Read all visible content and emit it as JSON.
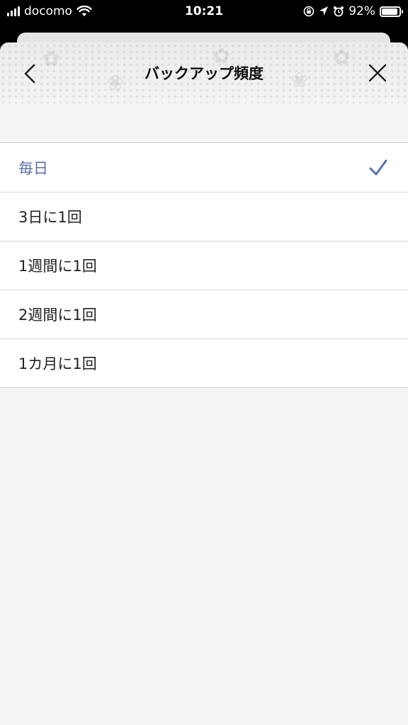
{
  "status_bar": {
    "carrier": "docomo",
    "time": "10:21",
    "battery": "92%",
    "battery_level": 0.92,
    "icons": [
      "signal-icon",
      "wifi-icon",
      "orientation-lock-icon",
      "location-icon",
      "alarm-icon",
      "battery-icon"
    ]
  },
  "header": {
    "title": "バックアップ頻度",
    "back_icon": "chevron-left-icon",
    "close_icon": "close-icon"
  },
  "options": [
    {
      "label": "毎日",
      "selected": true
    },
    {
      "label": "3日に1回",
      "selected": false
    },
    {
      "label": "1週間に1回",
      "selected": false
    },
    {
      "label": "2週間に1回",
      "selected": false
    },
    {
      "label": "1カ月に1回",
      "selected": false
    }
  ],
  "colors": {
    "accent": "#5a6fae",
    "background": "#f4f4f4",
    "text": "#222222"
  }
}
